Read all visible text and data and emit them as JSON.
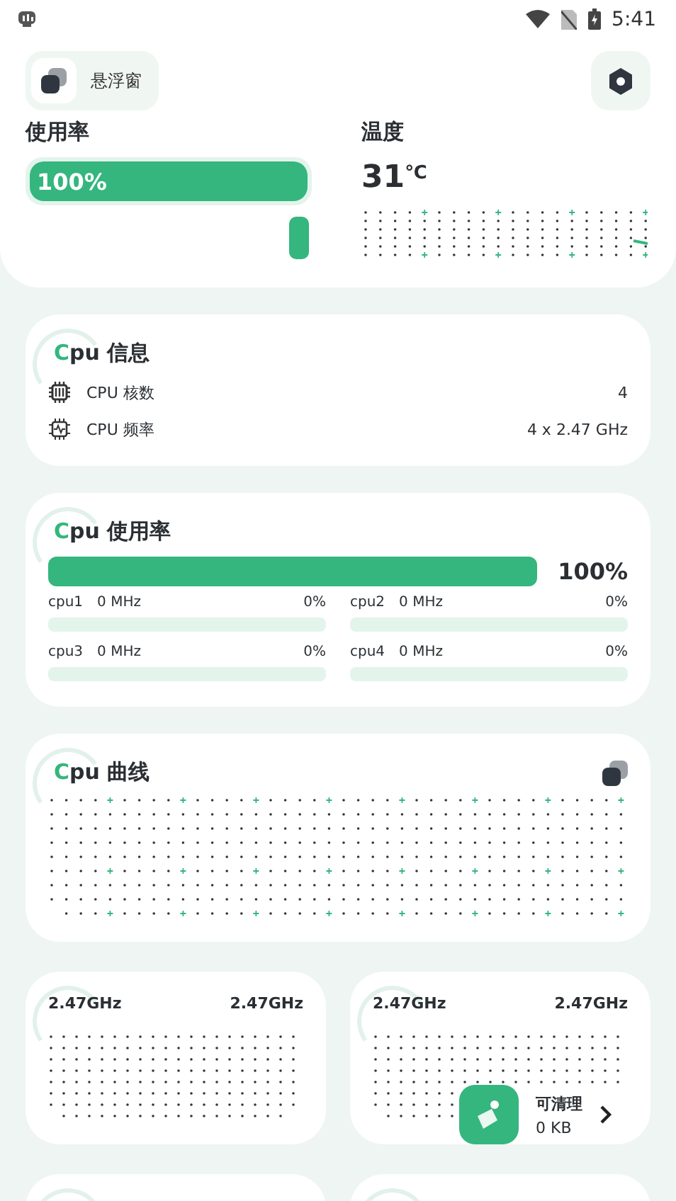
{
  "status_bar": {
    "time": "5:41"
  },
  "floating_window": {
    "label": "悬浮窗"
  },
  "usage": {
    "title": "使用率",
    "level": 1,
    "reading": "100%"
  },
  "temperature": {
    "title": "温度",
    "value": "31",
    "unit": "℃"
  },
  "cpu_info": {
    "title": "Cpu 信息",
    "rows": [
      {
        "kind": "cores",
        "label": "CPU 核数",
        "value": "4"
      },
      {
        "kind": "frequency",
        "label": "CPU 频率",
        "value": "4 x 2.47 GHz"
      }
    ]
  },
  "cpu_usage": {
    "title": "Cpu 使用率",
    "level": 1,
    "reading": "100%",
    "cores": [
      {
        "name": "cpu1",
        "freq": "0 MHz",
        "percent": "0%",
        "level": 0
      },
      {
        "name": "cpu2",
        "freq": "0 MHz",
        "percent": "0%",
        "level": 0
      },
      {
        "name": "cpu3",
        "freq": "0 MHz",
        "percent": "0%",
        "level": 0
      },
      {
        "name": "cpu4",
        "freq": "0 MHz",
        "percent": "0%",
        "level": 0
      }
    ]
  },
  "cpu_curve": {
    "title": "Cpu 曲线"
  },
  "freq_cards": [
    {
      "min": "2.47GHz",
      "max": "2.47GHz"
    },
    {
      "min": "2.47GHz",
      "max": "2.47GHz"
    }
  ],
  "clean_widget": {
    "label": "可清理",
    "size": "0 KB"
  }
}
